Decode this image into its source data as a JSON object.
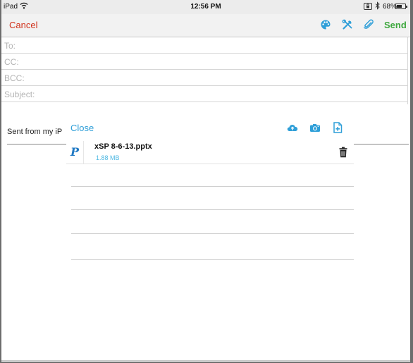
{
  "status_bar": {
    "carrier": "iPad",
    "time": "12:56 PM",
    "battery": "68%",
    "battery_level": 0.68,
    "icons": [
      "wifi-icon",
      "rotation-lock-icon",
      "bluetooth-icon",
      "battery-icon"
    ]
  },
  "toolbar": {
    "cancel_label": "Cancel",
    "send_label": "Send",
    "icons": [
      "palette-icon",
      "tools-icon",
      "paperclip-icon"
    ],
    "colors": {
      "cancel": "#d0301a",
      "send": "#3ea83e",
      "icon": "#2f9fd8"
    }
  },
  "compose": {
    "to_label": "To:",
    "cc_label": "CC:",
    "bcc_label": "BCC:",
    "subject_label": "Subject:",
    "body": "Sent from my iP"
  },
  "attachments_panel": {
    "close_label": "Close",
    "icons": [
      "cloud-upload-icon",
      "camera-icon",
      "add-file-icon"
    ],
    "items": [
      {
        "icon": "powerpoint-icon",
        "icon_glyph": "P",
        "name": "xSP 8-6-13.pptx",
        "size": "1.88 MB"
      }
    ]
  }
}
